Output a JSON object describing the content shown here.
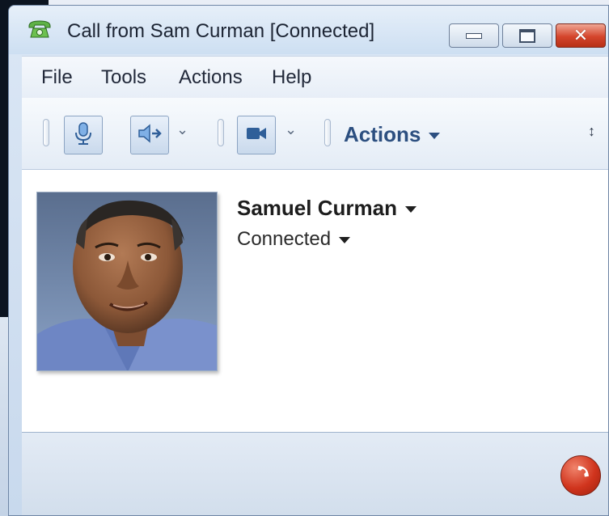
{
  "window": {
    "title": "Call from Sam Curman [Connected]"
  },
  "titlebar": {
    "icons": {
      "app": "phone-icon",
      "minimize": "minimize-icon",
      "maximize": "maximize-icon",
      "close": "close-icon"
    },
    "close_glyph": "✕"
  },
  "menubar": {
    "items": [
      "File",
      "Tools",
      "Actions",
      "Help"
    ]
  },
  "toolbar": {
    "icons": [
      "microphone-icon",
      "speaker-transfer-icon",
      "video-camera-icon"
    ],
    "actions_label": "Actions",
    "more_glyph": "»",
    "overflow_glyph": "↕"
  },
  "contact": {
    "name": "Samuel Curman",
    "status": "Connected",
    "avatar_icon": "contact-photo"
  },
  "footer": {
    "hangup_icon": "hang-up-icon"
  },
  "colors": {
    "accent": "#2c4f80",
    "hangup": "#d0341d",
    "close_button": "#d4452c"
  }
}
